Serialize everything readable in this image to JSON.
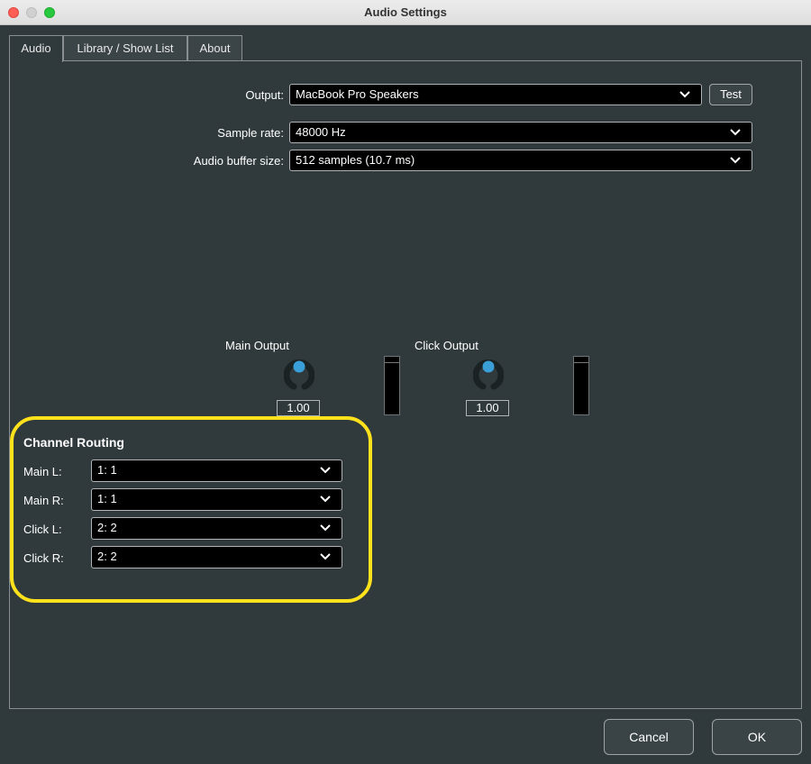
{
  "window": {
    "title": "Audio Settings"
  },
  "tabs": [
    {
      "label": "Audio",
      "active": true
    },
    {
      "label": "Library / Show List",
      "active": false
    },
    {
      "label": "About",
      "active": false
    }
  ],
  "audio": {
    "output_label": "Output:",
    "output_value": "MacBook Pro Speakers",
    "test_label": "Test",
    "sample_rate_label": "Sample rate:",
    "sample_rate_value": "48000 Hz",
    "buffer_label": "Audio buffer size:",
    "buffer_value": "512 samples (10.7 ms)"
  },
  "levels": {
    "main": {
      "label": "Main Output",
      "value": "1.00"
    },
    "click": {
      "label": "Click Output",
      "value": "1.00"
    }
  },
  "routing": {
    "title": "Channel Routing",
    "rows": [
      {
        "label": "Main L:",
        "value": "1: 1"
      },
      {
        "label": "Main R:",
        "value": "1: 1"
      },
      {
        "label": "Click L:",
        "value": "2: 2"
      },
      {
        "label": "Click R:",
        "value": "2: 2"
      }
    ]
  },
  "footer": {
    "cancel_label": "Cancel",
    "ok_label": "OK"
  },
  "colors": {
    "background": "#303a3d",
    "highlight": "#ffe21c",
    "knob_accent": "#3a9fd8"
  }
}
